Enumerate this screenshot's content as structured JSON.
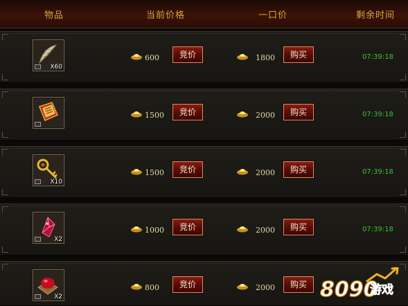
{
  "header": {
    "item": "物品",
    "current_price": "当前价格",
    "buyout_price": "一口价",
    "remaining_time": "剩余时间"
  },
  "labels": {
    "bid": "竞价",
    "buy": "购买"
  },
  "rows": [
    {
      "icon": "feather-icon",
      "qty": "X60",
      "current_price": "600",
      "buyout_price": "1800",
      "time": "07:39:18"
    },
    {
      "icon": "book-icon",
      "qty": "",
      "current_price": "1500",
      "buyout_price": "2000",
      "time": "07:39:18"
    },
    {
      "icon": "key-icon",
      "qty": "X10",
      "current_price": "1500",
      "buyout_price": "2000",
      "time": "07:39:18"
    },
    {
      "icon": "crystal-icon",
      "qty": "X2",
      "current_price": "1000",
      "buyout_price": "2000",
      "time": "07:39:18"
    },
    {
      "icon": "gem-chest-icon",
      "qty": "X2",
      "current_price": "800",
      "buyout_price": "2000",
      "time": ""
    }
  ],
  "watermark": {
    "digits": "8090",
    "text": "游戏"
  },
  "colors": {
    "header_text": "#d9a43a",
    "time_text": "#3fbe3a",
    "button_red": "#6a1008",
    "gold": "#f0c040"
  }
}
